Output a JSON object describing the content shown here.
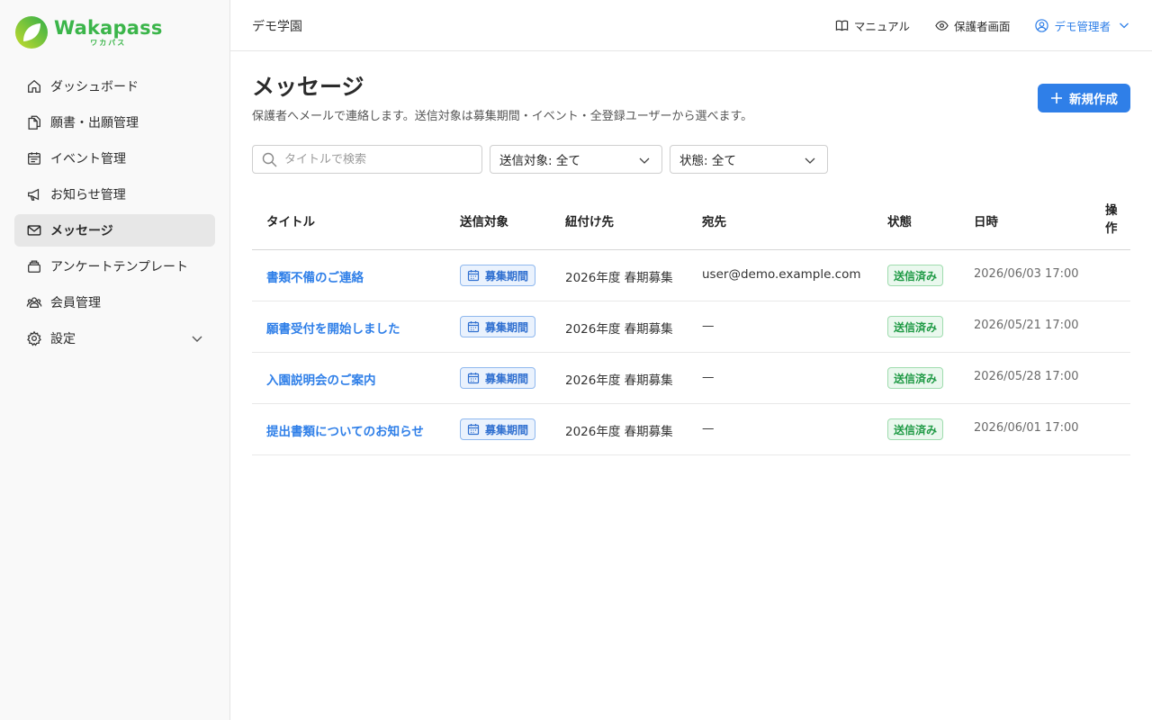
{
  "brand": {
    "name": "Wakapass",
    "sub": "ワカパス",
    "color": "#3bb54a"
  },
  "sidebar": {
    "items": [
      {
        "label": "ダッシュボード",
        "icon": "home-icon"
      },
      {
        "label": "願書・出願管理",
        "icon": "documents-icon"
      },
      {
        "label": "イベント管理",
        "icon": "calendar-icon"
      },
      {
        "label": "お知らせ管理",
        "icon": "megaphone-icon"
      },
      {
        "label": "メッセージ",
        "icon": "mail-icon",
        "active": true
      },
      {
        "label": "アンケートテンプレート",
        "icon": "template-icon"
      },
      {
        "label": "会員管理",
        "icon": "users-icon"
      },
      {
        "label": "設定",
        "icon": "gear-icon",
        "expandable": true
      }
    ]
  },
  "header": {
    "school": "デモ学園",
    "manual": "マニュアル",
    "guardian_view": "保護者画面",
    "user": "デモ管理者"
  },
  "page": {
    "title": "メッセージ",
    "description": "保護者へメールで連絡します。送信対象は募集期間・イベント・全登録ユーザーから選べます。",
    "new_button": "新規作成"
  },
  "filters": {
    "search_placeholder": "タイトルで検索",
    "target": "送信対象: 全て",
    "status": "状態: 全て"
  },
  "table": {
    "headers": {
      "title": "タイトル",
      "target": "送信対象",
      "linked": "紐付け先",
      "recipient": "宛先",
      "status": "状態",
      "datetime": "日時",
      "action": "操作"
    },
    "rows": [
      {
        "title": "書類不備のご連絡",
        "target": "募集期間",
        "linked": "2026年度 春期募集",
        "recipient": "user@demo.example.com",
        "status": "送信済み",
        "datetime": "2026/06/03 17:00"
      },
      {
        "title": "願書受付を開始しました",
        "target": "募集期間",
        "linked": "2026年度 春期募集",
        "recipient": "—",
        "status": "送信済み",
        "datetime": "2026/05/21 17:00"
      },
      {
        "title": "入園説明会のご案内",
        "target": "募集期間",
        "linked": "2026年度 春期募集",
        "recipient": "—",
        "status": "送信済み",
        "datetime": "2026/05/28 17:00"
      },
      {
        "title": "提出書類についてのお知らせ",
        "target": "募集期間",
        "linked": "2026年度 春期募集",
        "recipient": "—",
        "status": "送信済み",
        "datetime": "2026/06/01 17:00"
      }
    ]
  },
  "colors": {
    "accent": "#2f7fe8",
    "success": "#1f9a45"
  }
}
